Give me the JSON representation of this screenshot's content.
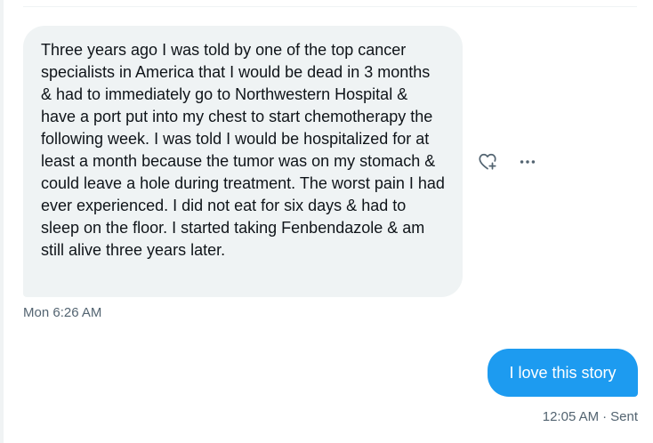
{
  "conversation": {
    "received_message": {
      "text": "Three years ago I was told by one of the top cancer specialists in America that I would be dead in 3 months & had to immediately go to Northwestern Hospital & have a port put into my chest to start chemotherapy the following week. I was told I would be hospitalized for at least a month because the tumor was on my stomach & could leave a hole during treatment. The worst pain I had ever experienced. I did not eat for six days & had to sleep on the floor. I started taking Fenbendazole & am still alive three years later.",
      "timestamp": "Mon 6:26 AM",
      "actions": {
        "react_icon": "heart-plus-icon",
        "more_icon": "more-horizontal-icon"
      }
    },
    "sent_message": {
      "text": "I love this story",
      "timestamp": "12:05 AM",
      "separator": "·",
      "status": "Sent"
    }
  },
  "colors": {
    "received_bubble": "#eff3f4",
    "sent_bubble": "#1d9bf0",
    "secondary_text": "#536471",
    "primary_text": "#0f1419"
  }
}
